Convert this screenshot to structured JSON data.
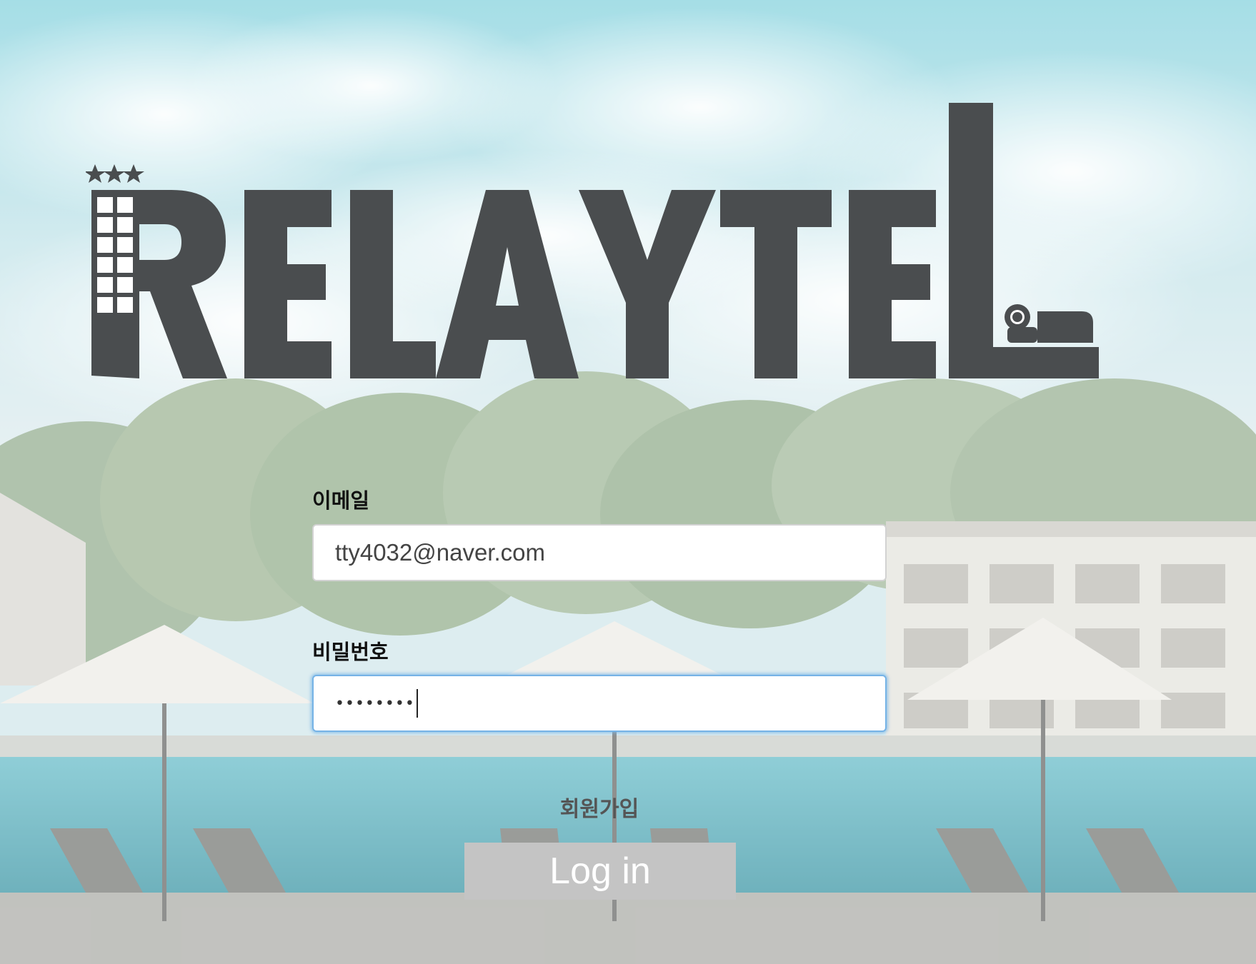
{
  "brand": {
    "logo_text": "RELAYTEL",
    "logo_color": "#4a4d4f"
  },
  "form": {
    "email_label": "이메일",
    "email_value": "tty4032@naver.com",
    "password_label": "비밀번호",
    "password_value": "••••••••",
    "signup_link": "회원가입",
    "login_button": "Log in"
  },
  "colors": {
    "focus_ring": "#76b3e6",
    "button_bg": "#c4c4c4",
    "button_text": "#ffffff"
  },
  "background": {
    "scene": "hotel-pool-photo"
  }
}
